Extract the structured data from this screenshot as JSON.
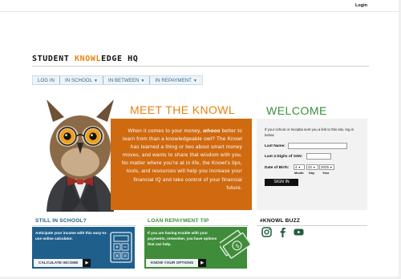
{
  "header": {
    "login_label": "Login"
  },
  "logo": {
    "part1": "STUDENT ",
    "part2": "KNOWL",
    "part3": "EDGE HQ"
  },
  "nav": {
    "items": [
      {
        "label": "LOG IN"
      },
      {
        "label": "IN SCHOOL"
      },
      {
        "label": "IN BETWEEN"
      },
      {
        "label": "IN REPAYMENT"
      }
    ]
  },
  "meet": {
    "title": "MEET THE KNOWL",
    "text_before": "When it comes to your money, ",
    "text_emphasis": "whooo",
    "text_after": " better to learn from than a knowledgeable owl? The Knowl has learned a thing or two about smart money moves, and wants to share that wisdom with you. No matter where you're at in life, the Knowl's tips, tools, and resources will help you increase your financial IQ and take control of your financial future."
  },
  "welcome": {
    "title": "WELCOME",
    "intro": "If your school or Inceptia sent you a link to this site, log in below.",
    "last_name_label": "Last Name:",
    "ssn_label": "Last 4 Digits of SSN:",
    "dob_label": "Date of Birth:",
    "dob_month": "4",
    "dob_day": "22",
    "dob_year": "2025",
    "month_label": "Month",
    "day_label": "Day",
    "year_label": "Year",
    "signin_label": "SIGN IN"
  },
  "still_in_school": {
    "heading": "STILL IN SCHOOL?",
    "text": "Anticipate your income with this easy-to-use online calculator.",
    "button_label": "CALCULATE INCOME"
  },
  "repayment_tip": {
    "heading": "LOAN REPAYMENT TIP",
    "text": "If you are having trouble with your payments, remember, you have options that can help.",
    "button_label": "KNOW YOUR OPTIONS"
  },
  "buzz": {
    "heading": "#KNOWL BUZZ",
    "icons": [
      "instagram-icon",
      "facebook-icon",
      "youtube-icon"
    ]
  },
  "colors": {
    "orange": "#d06a10",
    "orange_title": "#e8830e",
    "green_title": "#3a8f3c",
    "blue_card": "#1e5f8c",
    "green_card": "#3f8c3a",
    "nav_text": "#2a6f95"
  }
}
